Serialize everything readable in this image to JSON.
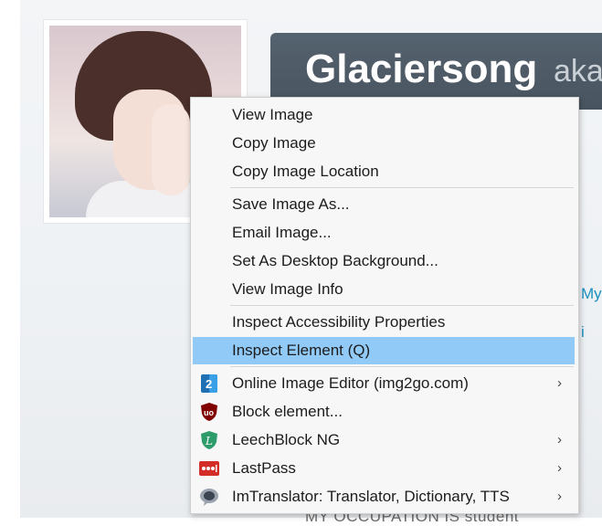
{
  "page": {
    "title_name": "Glaciersong",
    "title_aka": "aka",
    "side_link_1": "My",
    "side_link_2": "i",
    "occupation_text": "MY OCCUPATION IS student"
  },
  "context_menu": {
    "items": [
      {
        "label": "View Image"
      },
      {
        "label": "Copy Image"
      },
      {
        "label": "Copy Image Location"
      },
      {
        "label": "Save Image As..."
      },
      {
        "label": "Email Image..."
      },
      {
        "label": "Set As Desktop Background..."
      },
      {
        "label": "View Image Info"
      },
      {
        "label": "Inspect Accessibility Properties"
      },
      {
        "label": "Inspect Element (Q)"
      },
      {
        "label": "Online Image Editor (img2go.com)",
        "icon": "img2go-icon"
      },
      {
        "label": "Block element...",
        "icon": "ublock-origin-icon"
      },
      {
        "label": "LeechBlock NG",
        "icon": "leechblock-icon"
      },
      {
        "label": "LastPass",
        "icon": "lastpass-icon"
      },
      {
        "label": "ImTranslator: Translator, Dictionary, TTS",
        "icon": "imtranslator-icon"
      }
    ],
    "highlight_color": "#91c9f7"
  },
  "colors": {
    "title_bar": "#4f5b66",
    "link": "#1b8fbf"
  }
}
